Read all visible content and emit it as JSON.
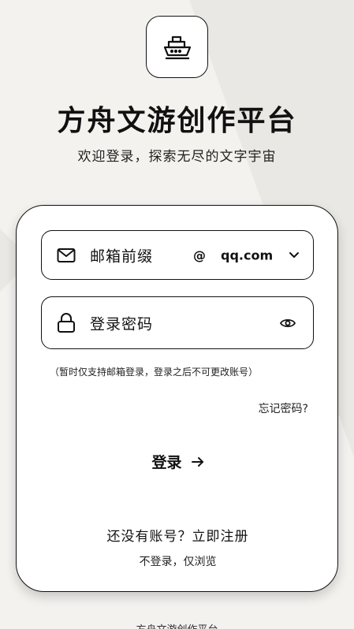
{
  "app": {
    "title": "方舟文游创作平台",
    "subtitle": "欢迎登录，探索无尽的文字宇宙",
    "logo_icon": "ship-icon"
  },
  "form": {
    "email_placeholder": "邮箱前缀",
    "email_at": "@",
    "email_domain": "qq.com",
    "password_placeholder": "登录密码",
    "note": "（暂时仅支持邮箱登录，登录之后不可更改账号）",
    "forgot_label": "忘记密码?",
    "login_label": "登录",
    "register_label": "还没有账号？立即注册",
    "browse_label": "不登录，仅浏览"
  },
  "footer": {
    "text": "方舟文游创作平台"
  },
  "colors": {
    "background": "#f3f2ef",
    "card": "#ffffff",
    "ink": "#111111"
  }
}
